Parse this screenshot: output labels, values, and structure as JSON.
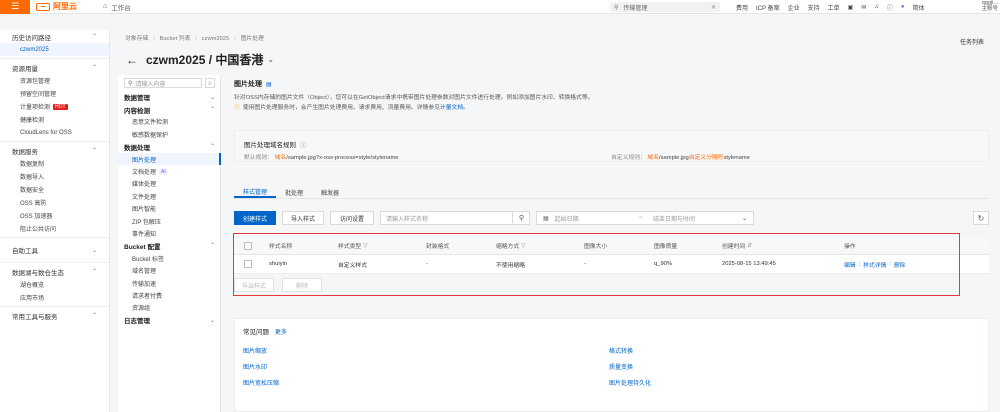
{
  "topbar": {
    "logo_text": "阿里云",
    "workbench": "工作台",
    "search_value": "传输管理",
    "links": [
      "费用",
      "ICP 备案",
      "企业",
      "支持",
      "工单"
    ],
    "lang": "简体",
    "user_name": "qggji...",
    "user_role": "主账号"
  },
  "leftnav": {
    "history_title": "历史访问路径",
    "history_item": "czwm2025",
    "usage_title": "资源用量",
    "usage_items": [
      "资源包管理",
      "预留空间管理",
      "计量项检测",
      "健康检测",
      "CloudLens for OSS"
    ],
    "hot_label": "HOT",
    "data_service_title": "数据服务",
    "data_service_items": [
      "数据复制",
      "数据导入",
      "数据安全",
      "OSS 高防",
      "OSS 加速器",
      "阻止公共访问"
    ],
    "self_tools_title": "自助工具",
    "ecosystem_title": "数据湖与数仓生态",
    "ecosystem_items": [
      "湖仓概览",
      "应用市场"
    ],
    "common_tools_title": "常用工具与服务"
  },
  "subnav": {
    "search_placeholder": "请输入内容",
    "groups": {
      "data_mgmt": "数据管理",
      "content_detect": "内容检测",
      "data_process": "数据处理",
      "bucket_config": "Bucket 配置",
      "log_mgmt": "日志管理"
    },
    "content_items": [
      "恶意文件检测",
      "敏感数据保护"
    ],
    "process_items": [
      "图片处理",
      "文档处理",
      "媒体处理",
      "文件处理",
      "图片智能",
      "ZIP 包解压",
      "事件通知"
    ],
    "ai_label": "AI",
    "bucket_items": [
      "Bucket 标签",
      "域名管理",
      "传输加速",
      "请求者付费",
      "资源组"
    ]
  },
  "breadcrumb": [
    "对象存储",
    "Bucket 列表",
    "czwm2025",
    "图片处理"
  ],
  "task_list": "任务列表",
  "page_title": "czwm2025 / 中国香港",
  "section": {
    "title": "图片处理",
    "desc1": "针对OSS内存储的图片文件（Object），您可以在GetObject请求中携带图片处理参数对图片文件进行处理。例如添加图片水印、转换格式等。",
    "desc2_prefix": "使用图片处理服务时，会产生图片处理费用、请求费用、流量费用。详情参见",
    "desc2_link": "计量文档",
    "desc2_suffix": "。"
  },
  "rule": {
    "title": "图片处理域名规则",
    "default_label": "默认规则：",
    "default_domain": "域名",
    "default_path": "/sample.jpg?x-oss-process=style/stylename",
    "custom_label": "自定义规则：",
    "custom_domain": "域名",
    "custom_path": "/sample.jpg",
    "custom_sep": "自定义分隔符",
    "custom_tail": "stylename"
  },
  "tabs": [
    "样式管理",
    "批处理",
    "触发器"
  ],
  "toolbar": {
    "create": "创建样式",
    "import": "导入样式",
    "access": "访问设置",
    "search_placeholder": "请输入样式名称",
    "start_date": "起始日期",
    "tilde": "~",
    "end_date": "结束日期与时间"
  },
  "table": {
    "headers": [
      "样式名称",
      "样式类型",
      "封装格式",
      "缩略方式",
      "图像大小",
      "图像质量",
      "创建时间",
      "操作"
    ],
    "rows": [
      {
        "name": "shuiyin",
        "type": "自定义样式",
        "format": "-",
        "thumb": "不使用缩略",
        "size": "-",
        "quality": "q_90%",
        "created": "2025-08-15 13:49:45"
      }
    ],
    "ops": [
      "编辑",
      "样式详情",
      "删除"
    ],
    "export": "导出样式",
    "delete": "删除"
  },
  "faq": {
    "title": "常见问题",
    "more": "更多",
    "links": [
      "图片缩放",
      "格式转换",
      "图片水印",
      "质量变换",
      "图片宽松压缩",
      "图片处理持久化"
    ]
  }
}
